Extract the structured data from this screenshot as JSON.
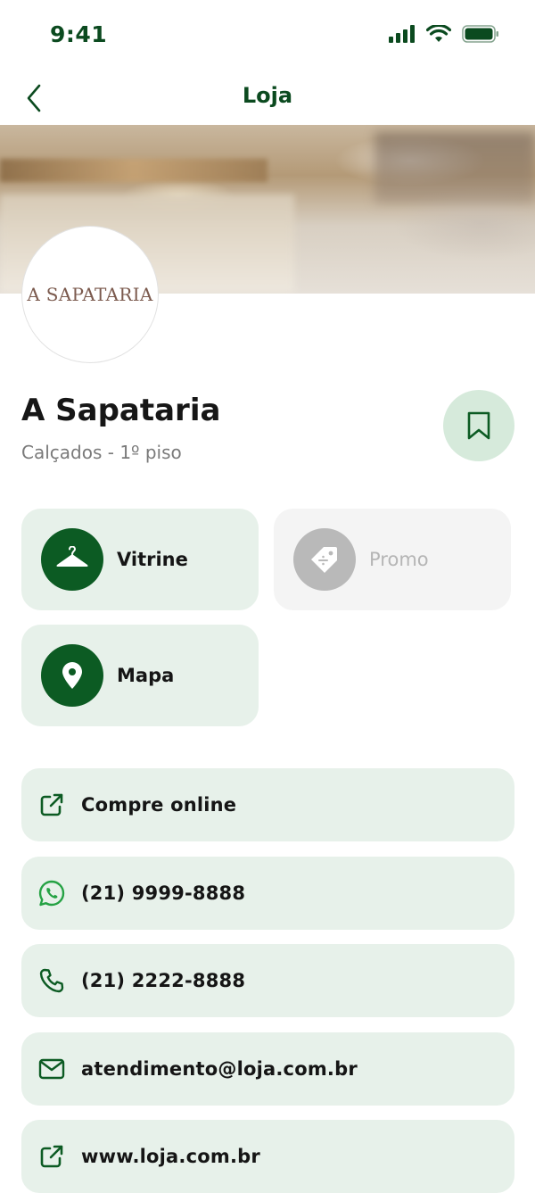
{
  "status_bar": {
    "time": "9:41"
  },
  "nav": {
    "title": "Loja"
  },
  "store": {
    "logo_text": "A SAPATARIA",
    "name": "A Sapataria",
    "subtitle": "Calçados - 1º piso"
  },
  "actions": [
    {
      "label": "Vitrine",
      "icon": "hanger-icon",
      "enabled": true
    },
    {
      "label": "Promo",
      "icon": "tag-icon",
      "enabled": false
    },
    {
      "label": "Mapa",
      "icon": "map-pin-icon",
      "enabled": true
    }
  ],
  "links": [
    {
      "label": "Compre online",
      "icon": "external-link-icon"
    },
    {
      "label": "(21) 9999-8888",
      "icon": "whatsapp-icon"
    },
    {
      "label": "(21) 2222-8888",
      "icon": "phone-icon"
    },
    {
      "label": "atendimento@loja.com.br",
      "icon": "mail-icon"
    },
    {
      "label": "www.loja.com.br",
      "icon": "external-link-icon"
    }
  ],
  "colors": {
    "brand": "#0c5b23",
    "card_bg": "#e7f1ea",
    "whatsapp": "#25a244"
  }
}
